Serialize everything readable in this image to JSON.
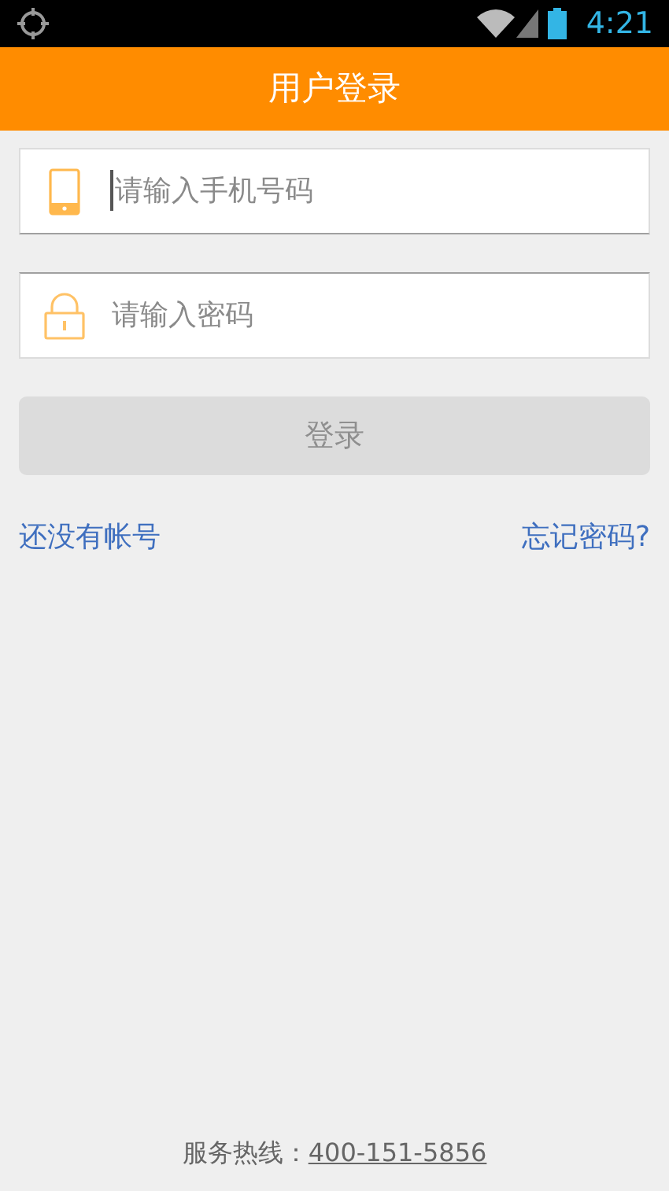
{
  "status_bar": {
    "time": "4:21"
  },
  "header": {
    "title": "用户登录"
  },
  "fields": [
    {
      "kind": "phone",
      "placeholder": "请输入手机号码",
      "focused": true
    },
    {
      "kind": "password",
      "placeholder": "请输入密码",
      "focused": false
    }
  ],
  "login_button": {
    "label": "登录",
    "disabled": true
  },
  "links": [
    {
      "label": "还没有帐号"
    },
    {
      "label": "忘记密码?"
    }
  ],
  "footer": {
    "label": "服务热线：",
    "phone": "400-151-5856"
  }
}
